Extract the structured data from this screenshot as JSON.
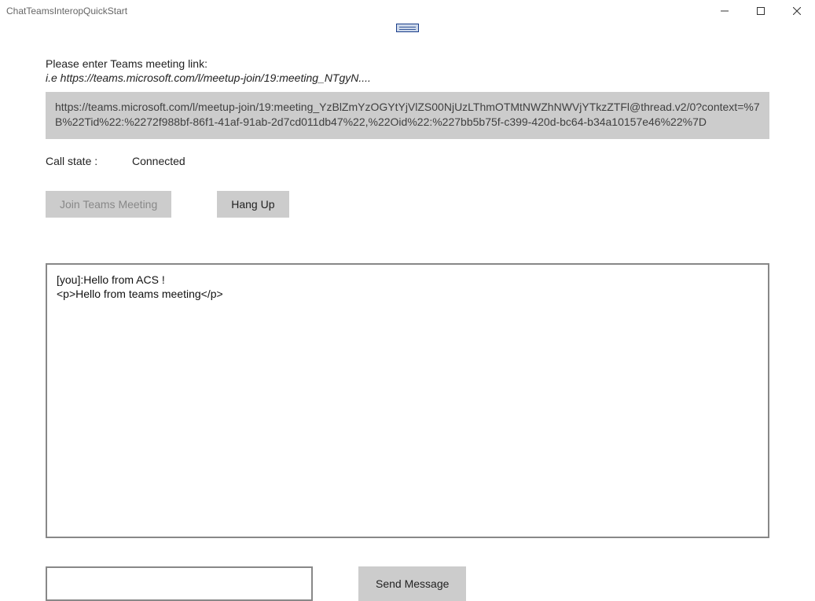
{
  "window": {
    "title": "ChatTeamsInteropQuickStart"
  },
  "prompt": {
    "label": "Please enter Teams meeting link:",
    "example": "i.e https://teams.microsoft.com/l/meetup-join/19:meeting_NTgyN....",
    "value": "https://teams.microsoft.com/l/meetup-join/19:meeting_YzBlZmYzOGYtYjVlZS00NjUzLThmOTMtNWZhNWVjYTkzZTFl@thread.v2/0?context=%7B%22Tid%22:%2272f988bf-86f1-41af-91ab-2d7cd011db47%22,%22Oid%22:%227bb5b75f-c399-420d-bc64-b34a10157e46%22%7D"
  },
  "status": {
    "label": "Call state :",
    "value": "Connected"
  },
  "buttons": {
    "join": "Join Teams Meeting",
    "hangup": "Hang Up",
    "send": "Send Message"
  },
  "chat": {
    "lines": [
      "[you]:Hello from ACS !",
      "<p>Hello from teams meeting</p>"
    ]
  },
  "compose": {
    "value": ""
  }
}
